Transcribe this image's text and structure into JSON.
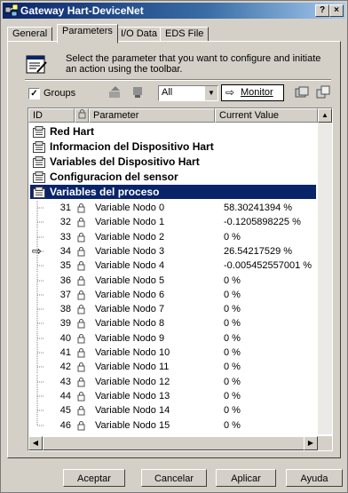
{
  "window": {
    "title": "Gateway Hart-DeviceNet",
    "help_label": "?",
    "close_label": "×"
  },
  "tabs": [
    {
      "label": "General"
    },
    {
      "label": "Parameters"
    },
    {
      "label": "I/O Data"
    },
    {
      "label": "EDS File"
    }
  ],
  "info": {
    "text": "Select the parameter that you want to configure and initiate an action using the toolbar."
  },
  "toolbar": {
    "groups_label": "Groups",
    "groups_checked": true,
    "filter_value": "All",
    "monitor_label": "Monitor"
  },
  "columns": {
    "id": "ID",
    "parameter": "Parameter",
    "value": "Current Value"
  },
  "groups": [
    {
      "label": "Red Hart"
    },
    {
      "label": "Informacion del Dispositivo Hart"
    },
    {
      "label": "Variables del Dispositivo Hart"
    },
    {
      "label": "Configuracion del sensor"
    },
    {
      "label": "Variables del proceso"
    }
  ],
  "rows": [
    {
      "id": "31",
      "name": "Variable Nodo 0",
      "value": "58.30241394 %"
    },
    {
      "id": "32",
      "name": "Variable Nodo 1",
      "value": "-0.1205898225 %"
    },
    {
      "id": "33",
      "name": "Variable Nodo 2",
      "value": "0 %"
    },
    {
      "id": "34",
      "name": "Variable Nodo 3",
      "value": "26.54217529 %"
    },
    {
      "id": "35",
      "name": "Variable Nodo 4",
      "value": "-0.005452557001 %"
    },
    {
      "id": "36",
      "name": "Variable Nodo 5",
      "value": "0 %"
    },
    {
      "id": "37",
      "name": "Variable Nodo 6",
      "value": "0 %"
    },
    {
      "id": "38",
      "name": "Variable Nodo 7",
      "value": "0 %"
    },
    {
      "id": "39",
      "name": "Variable Nodo 8",
      "value": "0 %"
    },
    {
      "id": "40",
      "name": "Variable Nodo 9",
      "value": "0 %"
    },
    {
      "id": "41",
      "name": "Variable Nodo 10",
      "value": "0 %"
    },
    {
      "id": "42",
      "name": "Variable Nodo 11",
      "value": "0 %"
    },
    {
      "id": "43",
      "name": "Variable Nodo 12",
      "value": "0 %"
    },
    {
      "id": "44",
      "name": "Variable Nodo 13",
      "value": "0 %"
    },
    {
      "id": "45",
      "name": "Variable Nodo 14",
      "value": "0 %"
    },
    {
      "id": "46",
      "name": "Variable Nodo 15",
      "value": "0 %"
    }
  ],
  "buttons": {
    "accept": "Aceptar",
    "cancel": "Cancelar",
    "apply": "Aplicar",
    "help": "Ayuda"
  },
  "colors": {
    "title_bar": "#0a246a",
    "selection": "#0a246a",
    "face": "#d4d0c8"
  }
}
